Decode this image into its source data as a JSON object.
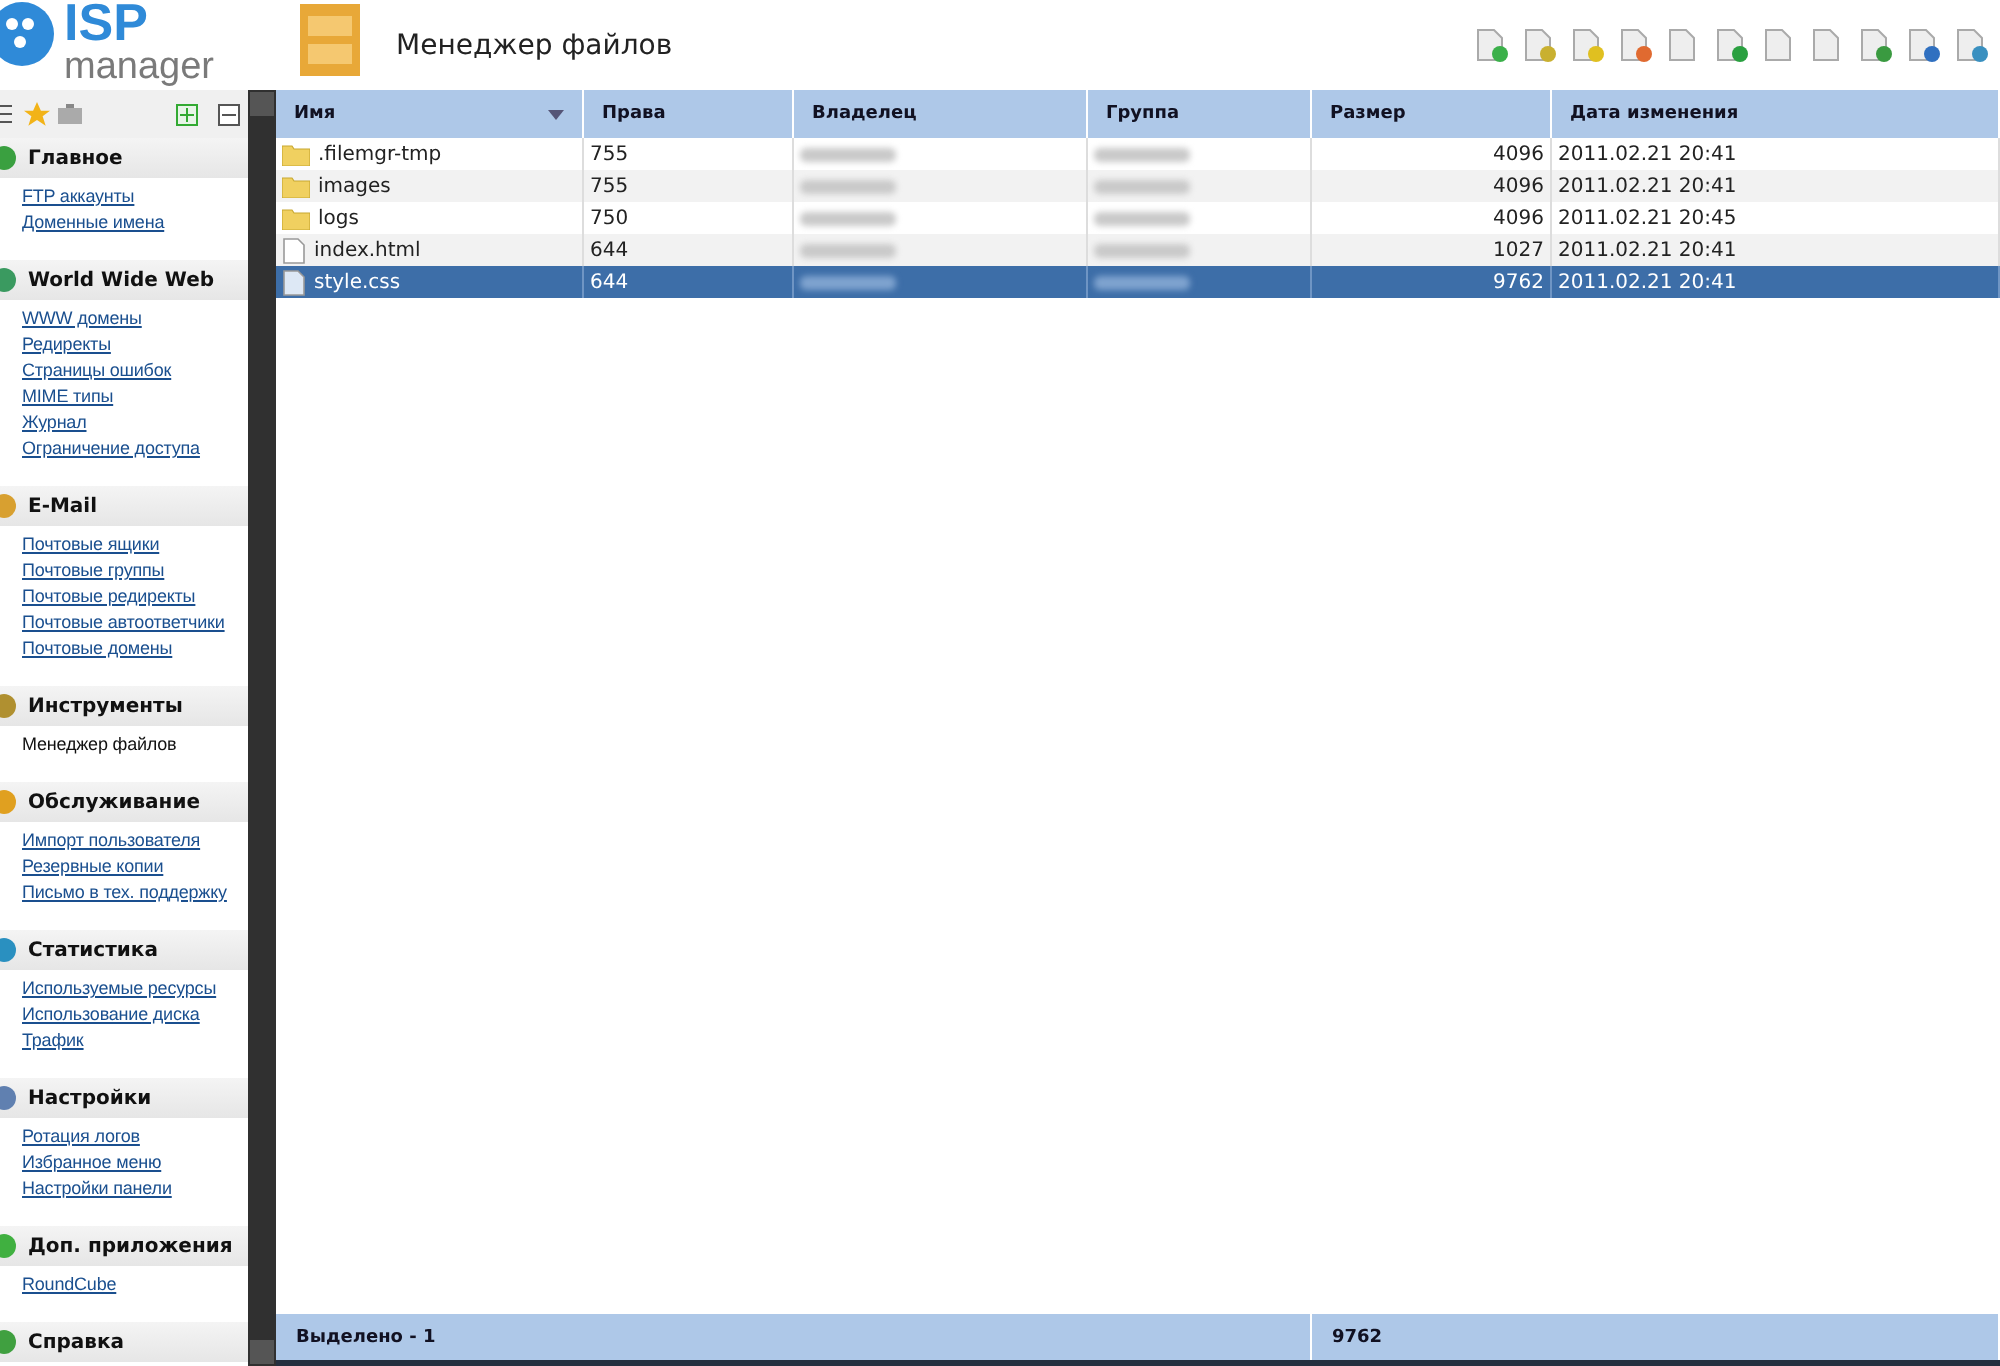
{
  "header": {
    "logo_top": "ISP",
    "logo_bottom": "manager",
    "title": "Менеджер файлов"
  },
  "sidebar": {
    "sections": [
      {
        "title": "Главное",
        "items": [
          {
            "label": "FTP аккаунты",
            "selected": false
          },
          {
            "label": "Доменные имена",
            "selected": false
          }
        ]
      },
      {
        "title": "World Wide Web",
        "items": [
          {
            "label": "WWW домены",
            "selected": false
          },
          {
            "label": "Редиректы",
            "selected": false
          },
          {
            "label": "Страницы ошибок",
            "selected": false
          },
          {
            "label": "MIME типы",
            "selected": false
          },
          {
            "label": "Журнал",
            "selected": false
          },
          {
            "label": "Ограничение доступа",
            "selected": false
          }
        ]
      },
      {
        "title": "E-Mail",
        "items": [
          {
            "label": "Почтовые ящики",
            "selected": false
          },
          {
            "label": "Почтовые группы",
            "selected": false
          },
          {
            "label": "Почтовые редиректы",
            "selected": false
          },
          {
            "label": "Почтовые автоответчики",
            "selected": false
          },
          {
            "label": "Почтовые домены",
            "selected": false
          }
        ]
      },
      {
        "title": "Инструменты",
        "items": [
          {
            "label": "Менеджер файлов",
            "selected": true
          }
        ]
      },
      {
        "title": "Обслуживание",
        "items": [
          {
            "label": "Импорт пользователя",
            "selected": false
          },
          {
            "label": "Резервные копии",
            "selected": false
          },
          {
            "label": "Письмо в тех. поддержку",
            "selected": false
          }
        ]
      },
      {
        "title": "Статистика",
        "items": [
          {
            "label": "Используемые ресурсы",
            "selected": false
          },
          {
            "label": "Использование диска",
            "selected": false
          },
          {
            "label": "Трафик",
            "selected": false
          }
        ]
      },
      {
        "title": "Настройки",
        "items": [
          {
            "label": "Ротация логов",
            "selected": false
          },
          {
            "label": "Избранное меню",
            "selected": false
          },
          {
            "label": "Настройки панели",
            "selected": false
          }
        ]
      },
      {
        "title": "Доп. приложения",
        "items": [
          {
            "label": "RoundCube",
            "selected": false
          }
        ]
      },
      {
        "title": "Справка"
      }
    ]
  },
  "table": {
    "columns": [
      "Имя",
      "Права",
      "Владелец",
      "Группа",
      "Размер",
      "Дата изменения"
    ],
    "rows": [
      {
        "kind": "folder",
        "name": ".filemgr-tmp",
        "rights": "755",
        "size": "4096",
        "modified": "2011.02.21 20:41",
        "selected": false
      },
      {
        "kind": "folder",
        "name": "images",
        "rights": "755",
        "size": "4096",
        "modified": "2011.02.21 20:41",
        "selected": false
      },
      {
        "kind": "folder",
        "name": "logs",
        "rights": "750",
        "size": "4096",
        "modified": "2011.02.21 20:45",
        "selected": false
      },
      {
        "kind": "file",
        "name": "index.html",
        "rights": "644",
        "size": "1027",
        "modified": "2011.02.21 20:41",
        "selected": false
      },
      {
        "kind": "file",
        "name": "style.css",
        "rights": "644",
        "size": "9762",
        "modified": "2011.02.21 20:41",
        "selected": true
      }
    ]
  },
  "status_bar": {
    "selected": "Выделено - 1",
    "total_size": "9762"
  }
}
